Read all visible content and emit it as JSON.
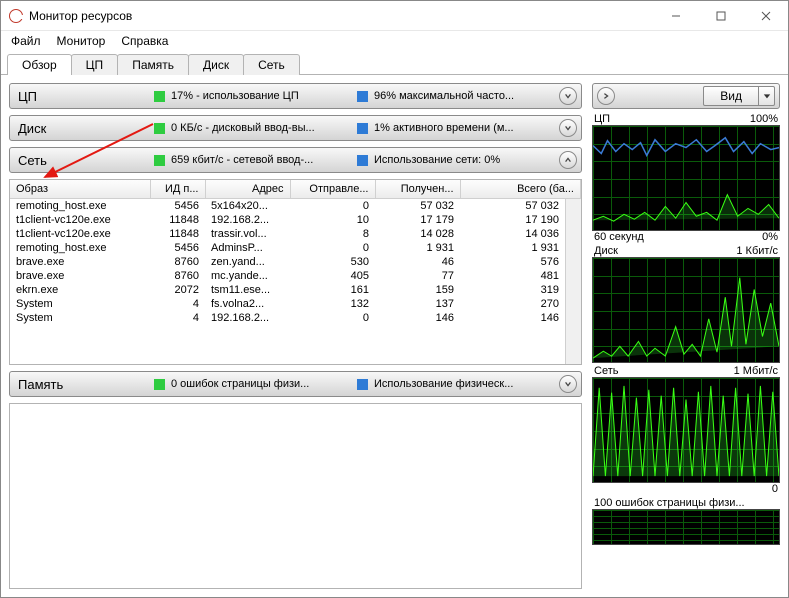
{
  "window": {
    "title": "Монитор ресурсов"
  },
  "menu": [
    "Файл",
    "Монитор",
    "Справка"
  ],
  "tabs": [
    "Обзор",
    "ЦП",
    "Память",
    "Диск",
    "Сеть"
  ],
  "bars": {
    "cpu": {
      "label": "ЦП",
      "stat1": "17% - использование ЦП",
      "stat2": "96% максимальной часто..."
    },
    "disk": {
      "label": "Диск",
      "stat1": "0 КБ/с - дисковый ввод-вы...",
      "stat2": "1% активного времени (м..."
    },
    "net": {
      "label": "Сеть",
      "stat1": "659 кбит/с - сетевой ввод-...",
      "stat2": "Использование сети: 0%"
    },
    "mem": {
      "label": "Память",
      "stat1": "0 ошибок страницы физи...",
      "stat2": "Использование физическ..."
    }
  },
  "table": {
    "cols": [
      "Образ",
      "ИД п...",
      "Адрес",
      "Отправле...",
      "Получен...",
      "Всего (ба..."
    ],
    "rows": [
      [
        "remoting_host.exe",
        "5456",
        "5x164x20...",
        "0",
        "57 032",
        "57 032"
      ],
      [
        "t1client-vc120e.exe",
        "11848",
        "192.168.2...",
        "10",
        "17 179",
        "17 190"
      ],
      [
        "t1client-vc120e.exe",
        "11848",
        "trassir.vol...",
        "8",
        "14 028",
        "14 036"
      ],
      [
        "remoting_host.exe",
        "5456",
        "AdminsP...",
        "0",
        "1 931",
        "1 931"
      ],
      [
        "brave.exe",
        "8760",
        "zen.yand...",
        "530",
        "46",
        "576"
      ],
      [
        "brave.exe",
        "8760",
        "mc.yande...",
        "405",
        "77",
        "481"
      ],
      [
        "ekrn.exe",
        "2072",
        "tsm11.ese...",
        "161",
        "159",
        "319"
      ],
      [
        "System",
        "4",
        "fs.volna2...",
        "132",
        "137",
        "270"
      ],
      [
        "System",
        "4",
        "192.168.2...",
        "0",
        "146",
        "146"
      ]
    ]
  },
  "charts": {
    "cpu": {
      "title": "ЦП",
      "max": "100%",
      "footL": "60 секунд",
      "footR": "0%"
    },
    "disk": {
      "title": "Диск",
      "max": "1 Кбит/с"
    },
    "net": {
      "title": "Сеть",
      "max": "1 Мбит/с",
      "footR": "0"
    },
    "mem": {
      "title": "100 ошибок страницы физи..."
    }
  },
  "viewBtn": "Вид"
}
